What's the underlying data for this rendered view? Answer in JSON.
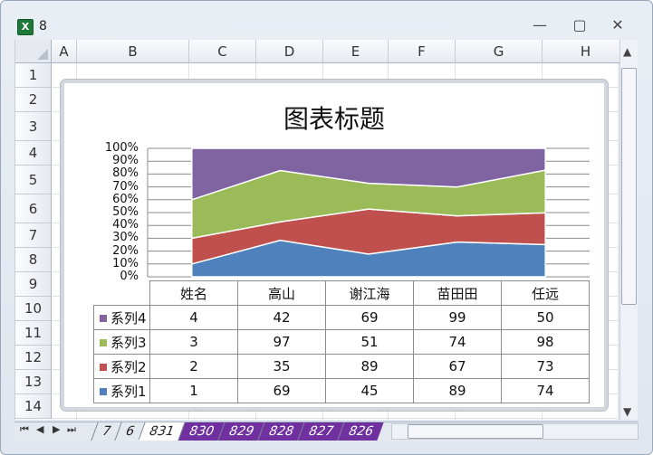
{
  "window": {
    "title": "8",
    "app_icon": "excel-icon",
    "minimize": "—",
    "restore": "▢",
    "close": "✕"
  },
  "columns": [
    "A",
    "B",
    "C",
    "D",
    "E",
    "F",
    "G",
    "H"
  ],
  "rows": [
    "1",
    "2",
    "3",
    "4",
    "5",
    "6",
    "7",
    "8",
    "9",
    "10",
    "11",
    "12",
    "13",
    "14"
  ],
  "chart_data": {
    "type": "area",
    "title": "图表标题",
    "stacking": "percent",
    "categories": [
      "姓名",
      "高山",
      "谢江海",
      "苗田田",
      "任远"
    ],
    "yticks": [
      "100%",
      "90%",
      "80%",
      "70%",
      "60%",
      "50%",
      "40%",
      "30%",
      "20%",
      "10%",
      "0%"
    ],
    "ylim": [
      0,
      100
    ],
    "grid": true,
    "series": [
      {
        "name": "系列1",
        "values": [
          1,
          69,
          45,
          89,
          74
        ],
        "color": "#4f81bd"
      },
      {
        "name": "系列2",
        "values": [
          2,
          35,
          89,
          67,
          73
        ],
        "color": "#c0504d"
      },
      {
        "name": "系列3",
        "values": [
          3,
          97,
          51,
          74,
          98
        ],
        "color": "#9bbb59"
      },
      {
        "name": "系列4",
        "values": [
          4,
          42,
          69,
          99,
          50
        ],
        "color": "#8064a2"
      }
    ]
  },
  "sheet_tabs": [
    "7",
    "6",
    "831",
    "830",
    "829",
    "828",
    "827",
    "826"
  ],
  "active_tab": "831",
  "tab_colors": {
    "active": "#ffffff",
    "purple": "#7030a0",
    "plain": "#e4e9f0"
  }
}
